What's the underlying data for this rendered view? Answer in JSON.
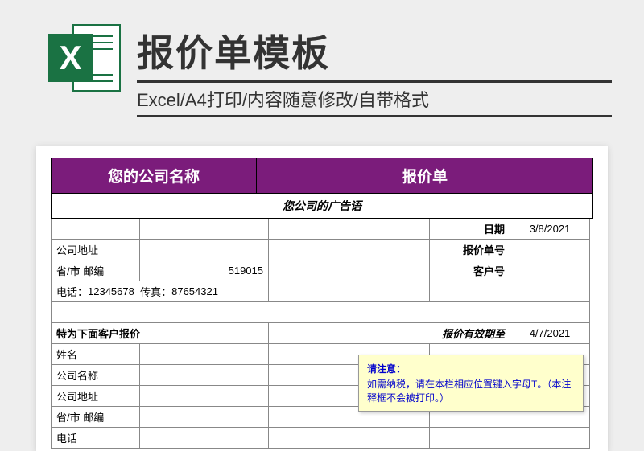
{
  "header": {
    "icon_letter": "X",
    "title": "报价单模板",
    "subtitle": "Excel/A4打印/内容随意修改/自带格式"
  },
  "quote": {
    "company_name_label": "您的公司名称",
    "quote_label": "报价单",
    "slogan": "您公司的广告语",
    "date_label": "日期",
    "date_value": "3/8/2021",
    "address_label": "公司地址",
    "quote_no_label": "报价单号",
    "province_label": "省/市 邮编",
    "postal_value": "519015",
    "customer_no_label": "客户号",
    "phone_prefix": "电话：",
    "phone_value": "12345678",
    "fax_prefix": "传真：",
    "fax_value": "87654321",
    "section_label": "特为下面客户报价",
    "valid_until_label": "报价有效期至",
    "valid_until_value": "4/7/2021",
    "name_label": "姓名",
    "company_label": "公司名称",
    "company_addr_label": "公司地址",
    "province2_label": "省/市 邮编",
    "phone2_label": "电话"
  },
  "note": {
    "title": "请注意：",
    "body": "如需纳税，请在本栏相应位置键入字母T。（本注释框不会被打印。）"
  }
}
